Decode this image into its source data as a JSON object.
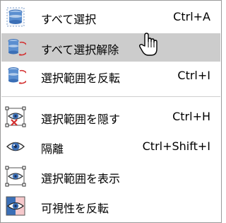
{
  "menu": {
    "items": [
      {
        "label": "すべて選択",
        "shortcut": "Ctrl+A",
        "icon": "select-all-icon"
      },
      {
        "label": "すべて選択解除",
        "shortcut": "",
        "icon": "deselect-all-icon"
      },
      {
        "label": "選択範囲を反転",
        "shortcut": "Ctrl+I",
        "icon": "invert-selection-icon"
      },
      {
        "label": "選択範囲を隠す",
        "shortcut": "Ctrl+H",
        "icon": "hide-selection-icon"
      },
      {
        "label": "隔離",
        "shortcut": "Ctrl+Shift+I",
        "icon": "isolate-eye-icon"
      },
      {
        "label": "選択範囲を表示",
        "shortcut": "",
        "icon": "show-selection-icon"
      },
      {
        "label": "可視性を反転",
        "shortcut": "",
        "icon": "invert-visibility-icon"
      }
    ],
    "hovered_item": "すべて選択解除"
  },
  "colors": {
    "hover_bg": "#cccccc",
    "icon_blue": "#3b6fb6",
    "icon_red": "#d32f2f"
  }
}
